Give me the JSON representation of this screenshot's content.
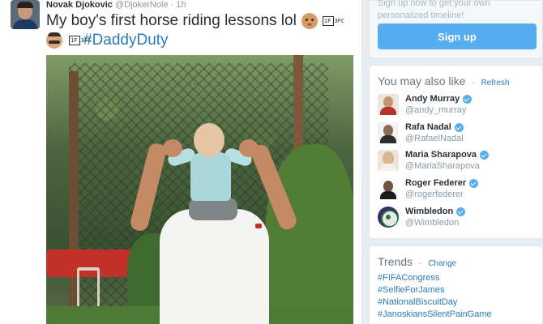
{
  "tweet": {
    "author_name": "Novak Djokovic",
    "author_handle": "@DjokerNole",
    "separator": "·",
    "time": "1h",
    "text_line1": "My boy's first horse riding lessons lol",
    "missing_glyph_1": "1F 3FC",
    "missing_glyph_2": "1F 3FC",
    "hashtag": "#DaddyDuty"
  },
  "signup": {
    "promo": "Sign up now to get your own personalized timeline!",
    "button_label": "Sign up"
  },
  "who_to_follow": {
    "title": "You may also like",
    "separator": "·",
    "refresh_label": "Refresh",
    "users": [
      {
        "name": "Andy Murray",
        "handle": "@andy_murray",
        "verified": true
      },
      {
        "name": "Rafa Nadal",
        "handle": "@RafaelNadal",
        "verified": true
      },
      {
        "name": "Maria Sharapova",
        "handle": "@MariaSharapova",
        "verified": true
      },
      {
        "name": "Roger Federer",
        "handle": "@rogerfederer",
        "verified": true
      },
      {
        "name": "Wimbledon",
        "handle": "@Wimbledon",
        "verified": true
      }
    ]
  },
  "trends": {
    "title": "Trends",
    "separator": "·",
    "change_label": "Change",
    "items": [
      "#FIFACongress",
      "#SelfieForJames",
      "#NationalBiscuitDay",
      "#JanoskiansSilentPainGame"
    ]
  },
  "colors": {
    "link": "#2b7bb9",
    "signup_button": "#55acee",
    "verified": "#55acee",
    "page_bg": "#e6ecf0"
  }
}
